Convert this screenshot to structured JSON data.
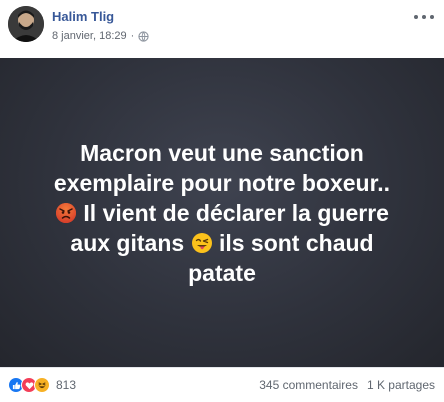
{
  "post": {
    "author": "Halim Tlig",
    "timestamp": "8 janvier, 18:29",
    "privacy_icon": "globe-icon",
    "background_color": "#2f323c",
    "text_lines": {
      "line1": "Macron veut une sanction",
      "line2": "exemplaire pour notre boxeur..",
      "line3": "Il vient de déclarer la guerre",
      "line4a": "aux gitans",
      "line4b": "ils sont chaud",
      "line5": "patate"
    },
    "emojis": [
      "angry-face-emoji",
      "tongue-wink-emoji"
    ]
  },
  "footer": {
    "reaction_icons": [
      "like-icon",
      "love-icon",
      "haha-icon"
    ],
    "reaction_count": "813",
    "comments": "345 commentaires",
    "shares": "1 K partages"
  },
  "colors": {
    "link_blue": "#385898",
    "like_blue": "#1877f2",
    "love_red": "#f33e58",
    "haha_yellow": "#f7b125"
  }
}
